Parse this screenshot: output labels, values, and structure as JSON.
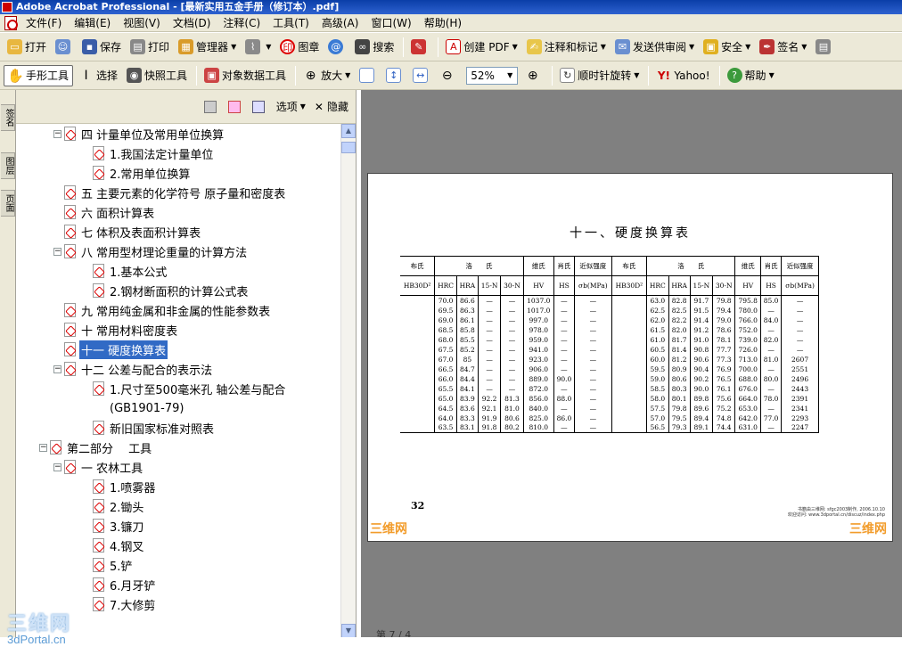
{
  "window": {
    "title": "Adobe Acrobat Professional - [最新实用五金手册（修订本）.pdf]"
  },
  "menu": [
    "文件(F)",
    "编辑(E)",
    "视图(V)",
    "文档(D)",
    "注释(C)",
    "工具(T)",
    "高级(A)",
    "窗口(W)",
    "帮助(H)"
  ],
  "toolbar1": {
    "open": "打开",
    "save": "保存",
    "print": "打印",
    "organizer": "管理器",
    "stamp": "图章",
    "search": "搜索",
    "create_pdf": "创建 PDF",
    "comment": "注释和标记",
    "send_review": "发送供审阅",
    "security": "安全",
    "sign": "签名"
  },
  "toolbar2": {
    "hand": "手形工具",
    "select": "选择",
    "snapshot": "快照工具",
    "object_data": "对象数据工具",
    "zoom_in": "放大",
    "zoom_value": "52%",
    "rotate": "顺时针旋转",
    "yahoo": "Yahoo!",
    "help": "帮助"
  },
  "side_tabs": [
    "签名",
    "图层",
    "页面"
  ],
  "panel": {
    "options": "选项",
    "hide": "隐藏"
  },
  "bookmarks": [
    {
      "label": "四 计量单位及常用单位换算",
      "level": 1,
      "expand": "−"
    },
    {
      "label": "1.我国法定计量单位",
      "level": 2
    },
    {
      "label": "2.常用单位换算",
      "level": 2
    },
    {
      "label": "五 主要元素的化学符号 原子量和密度表",
      "level": 1
    },
    {
      "label": "六 面积计算表",
      "level": 1
    },
    {
      "label": "七 体积及表面积计算表",
      "level": 1
    },
    {
      "label": "八 常用型材理论重量的计算方法",
      "level": 1,
      "expand": "−"
    },
    {
      "label": "1.基本公式",
      "level": 2
    },
    {
      "label": "2.钢材断面积的计算公式表",
      "level": 2
    },
    {
      "label": "九 常用纯金属和非金属的性能参数表",
      "level": 1
    },
    {
      "label": "十 常用材料密度表",
      "level": 1
    },
    {
      "label": "十一 硬度换算表",
      "level": 1,
      "selected": true
    },
    {
      "label": "十二 公差与配合的表示法",
      "level": 1,
      "expand": "−"
    },
    {
      "label": "1.尺寸至500毫米孔 轴公差与配合",
      "level": 2
    },
    {
      "label": "(GB1901-79)",
      "level": 2,
      "noicon": true
    },
    {
      "label": "新旧国家标准对照表",
      "level": 2
    },
    {
      "label": "第二部分　 工具",
      "level": 0,
      "expand": "−"
    },
    {
      "label": "一 农林工具",
      "level": 1,
      "expand": "−"
    },
    {
      "label": "1.喷雾器",
      "level": 2
    },
    {
      "label": "2.锄头",
      "level": 2
    },
    {
      "label": "3.镰刀",
      "level": 2
    },
    {
      "label": "4.钢叉",
      "level": 2
    },
    {
      "label": "5.铲",
      "level": 2
    },
    {
      "label": "6.月牙铲",
      "level": 2
    },
    {
      "label": "7.大修剪",
      "level": 2
    }
  ],
  "pdf_page": {
    "title": "十一、硬度换算表",
    "headers_top": [
      "布氏",
      "洛　　氏",
      "维氏",
      "肖氏",
      "近似强度",
      "布氏",
      "洛　　氏",
      "维氏",
      "肖氏",
      "近似强度"
    ],
    "headers_sub": [
      "HB30D²",
      "HRC",
      "HRA",
      "15-N",
      "30-N",
      "HV",
      "HS",
      "σb(MPa)",
      "HB30D²",
      "HRC",
      "HRA",
      "15-N",
      "30-N",
      "HV",
      "HS",
      "σb(MPa)"
    ],
    "rows": [
      [
        "",
        "70.0",
        "86.6",
        "—",
        "—",
        "1037.0",
        "—",
        "—",
        "",
        "63.0",
        "82.8",
        "91.7",
        "79.8",
        "795.8",
        "85.0",
        "—"
      ],
      [
        "",
        "69.5",
        "86.3",
        "—",
        "—",
        "1017.0",
        "—",
        "—",
        "",
        "62.5",
        "82.5",
        "91.5",
        "79.4",
        "780.0",
        "—",
        "—"
      ],
      [
        "",
        "69.0",
        "86.1",
        "—",
        "—",
        "997.0",
        "—",
        "—",
        "",
        "62.0",
        "82.2",
        "91.4",
        "79.0",
        "766.0",
        "84.0",
        "—"
      ],
      [
        "",
        "68.5",
        "85.8",
        "—",
        "—",
        "978.0",
        "—",
        "—",
        "",
        "61.5",
        "82.0",
        "91.2",
        "78.6",
        "752.0",
        "—",
        "—"
      ],
      [
        "",
        "68.0",
        "85.5",
        "—",
        "—",
        "959.0",
        "—",
        "—",
        "",
        "61.0",
        "81.7",
        "91.0",
        "78.1",
        "739.0",
        "82.0",
        "—"
      ],
      [
        "",
        "67.5",
        "85.2",
        "—",
        "—",
        "941.0",
        "—",
        "—",
        "",
        "60.5",
        "81.4",
        "90.8",
        "77.7",
        "726.0",
        "—",
        "—"
      ],
      [
        "",
        "67.0",
        "85",
        "—",
        "—",
        "923.0",
        "—",
        "—",
        "",
        "60.0",
        "81.2",
        "90.6",
        "77.3",
        "713.0",
        "81.0",
        "2607"
      ],
      [
        "",
        "66.5",
        "84.7",
        "—",
        "—",
        "906.0",
        "—",
        "—",
        "",
        "59.5",
        "80.9",
        "90.4",
        "76.9",
        "700.0",
        "—",
        "2551"
      ],
      [
        "",
        "66.0",
        "84.4",
        "—",
        "—",
        "889.0",
        "90.0",
        "—",
        "",
        "59.0",
        "80.6",
        "90.2",
        "76.5",
        "688.0",
        "80.0",
        "2496"
      ],
      [
        "",
        "65.5",
        "84.1",
        "—",
        "—",
        "872.0",
        "—",
        "—",
        "",
        "58.5",
        "80.3",
        "90.0",
        "76.1",
        "676.0",
        "—",
        "2443"
      ],
      [
        "",
        "65.0",
        "83.9",
        "92.2",
        "81.3",
        "856.0",
        "88.0",
        "—",
        "",
        "58.0",
        "80.1",
        "89.8",
        "75.6",
        "664.0",
        "78.0",
        "2391"
      ],
      [
        "",
        "64.5",
        "83.6",
        "92.1",
        "81.0",
        "840.0",
        "—",
        "—",
        "",
        "57.5",
        "79.8",
        "89.6",
        "75.2",
        "653.0",
        "—",
        "2341"
      ],
      [
        "",
        "64.0",
        "83.3",
        "91.9",
        "80.6",
        "825.0",
        "86.0",
        "—",
        "",
        "57.0",
        "79.5",
        "89.4",
        "74.8",
        "642.0",
        "77.0",
        "2293"
      ],
      [
        "",
        "63.5",
        "83.1",
        "91.8",
        "80.2",
        "810.0",
        "—",
        "—",
        "",
        "56.5",
        "79.3",
        "89.1",
        "74.4",
        "631.0",
        "—",
        "2247"
      ]
    ],
    "page_number": "32",
    "footer1": "书籍由三维网: sfgc2003制作, 2006.10.10",
    "footer2": "欢迎访问: www.3dportal.cn/discuz/index.php",
    "wm_left": "三维网",
    "wm_right": "三维网"
  },
  "status": {
    "page": "第 7 / 4"
  },
  "logo": {
    "name": "三维网",
    "url": "3dPortal.cn"
  }
}
